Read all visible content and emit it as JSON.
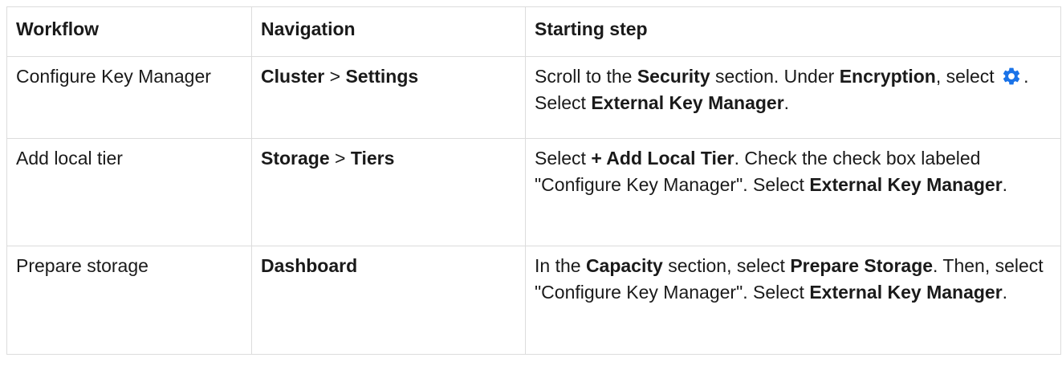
{
  "headers": {
    "workflow": "Workflow",
    "navigation": "Navigation",
    "starting_step": "Starting step"
  },
  "rows": [
    {
      "workflow": "Configure Key Manager",
      "navigation": {
        "first": "Cluster",
        "separator": " > ",
        "second": "Settings"
      },
      "step": {
        "t1": "Scroll to the ",
        "b1": "Security",
        "t2": " section. Under ",
        "b2": "Encryption",
        "t3": ", select ",
        "icon": "gear-icon",
        "t4": ". Select ",
        "b3": "External Key Manager",
        "t5": "."
      }
    },
    {
      "workflow": "Add local tier",
      "navigation": {
        "first": "Storage",
        "separator": " > ",
        "second": "Tiers"
      },
      "step": {
        "t1": "Select ",
        "b1": "+ Add Local Tier",
        "t2": ". Check the check box labeled \"Configure Key Manager\". Select ",
        "b2": "External Key Manager",
        "t3": "."
      }
    },
    {
      "workflow": "Prepare storage",
      "navigation": {
        "first": "Dashboard"
      },
      "step": {
        "t1": "In the ",
        "b1": "Capacity",
        "t2": " section, select ",
        "b2": "Prepare Storage",
        "t3": ". Then, select \"Configure Key Manager\". Select ",
        "b3": "External Key Manager",
        "t4": "."
      }
    }
  ],
  "colors": {
    "border": "#dcdcdc",
    "text": "#1a1a1a",
    "gear_icon": "#1a73e8"
  }
}
